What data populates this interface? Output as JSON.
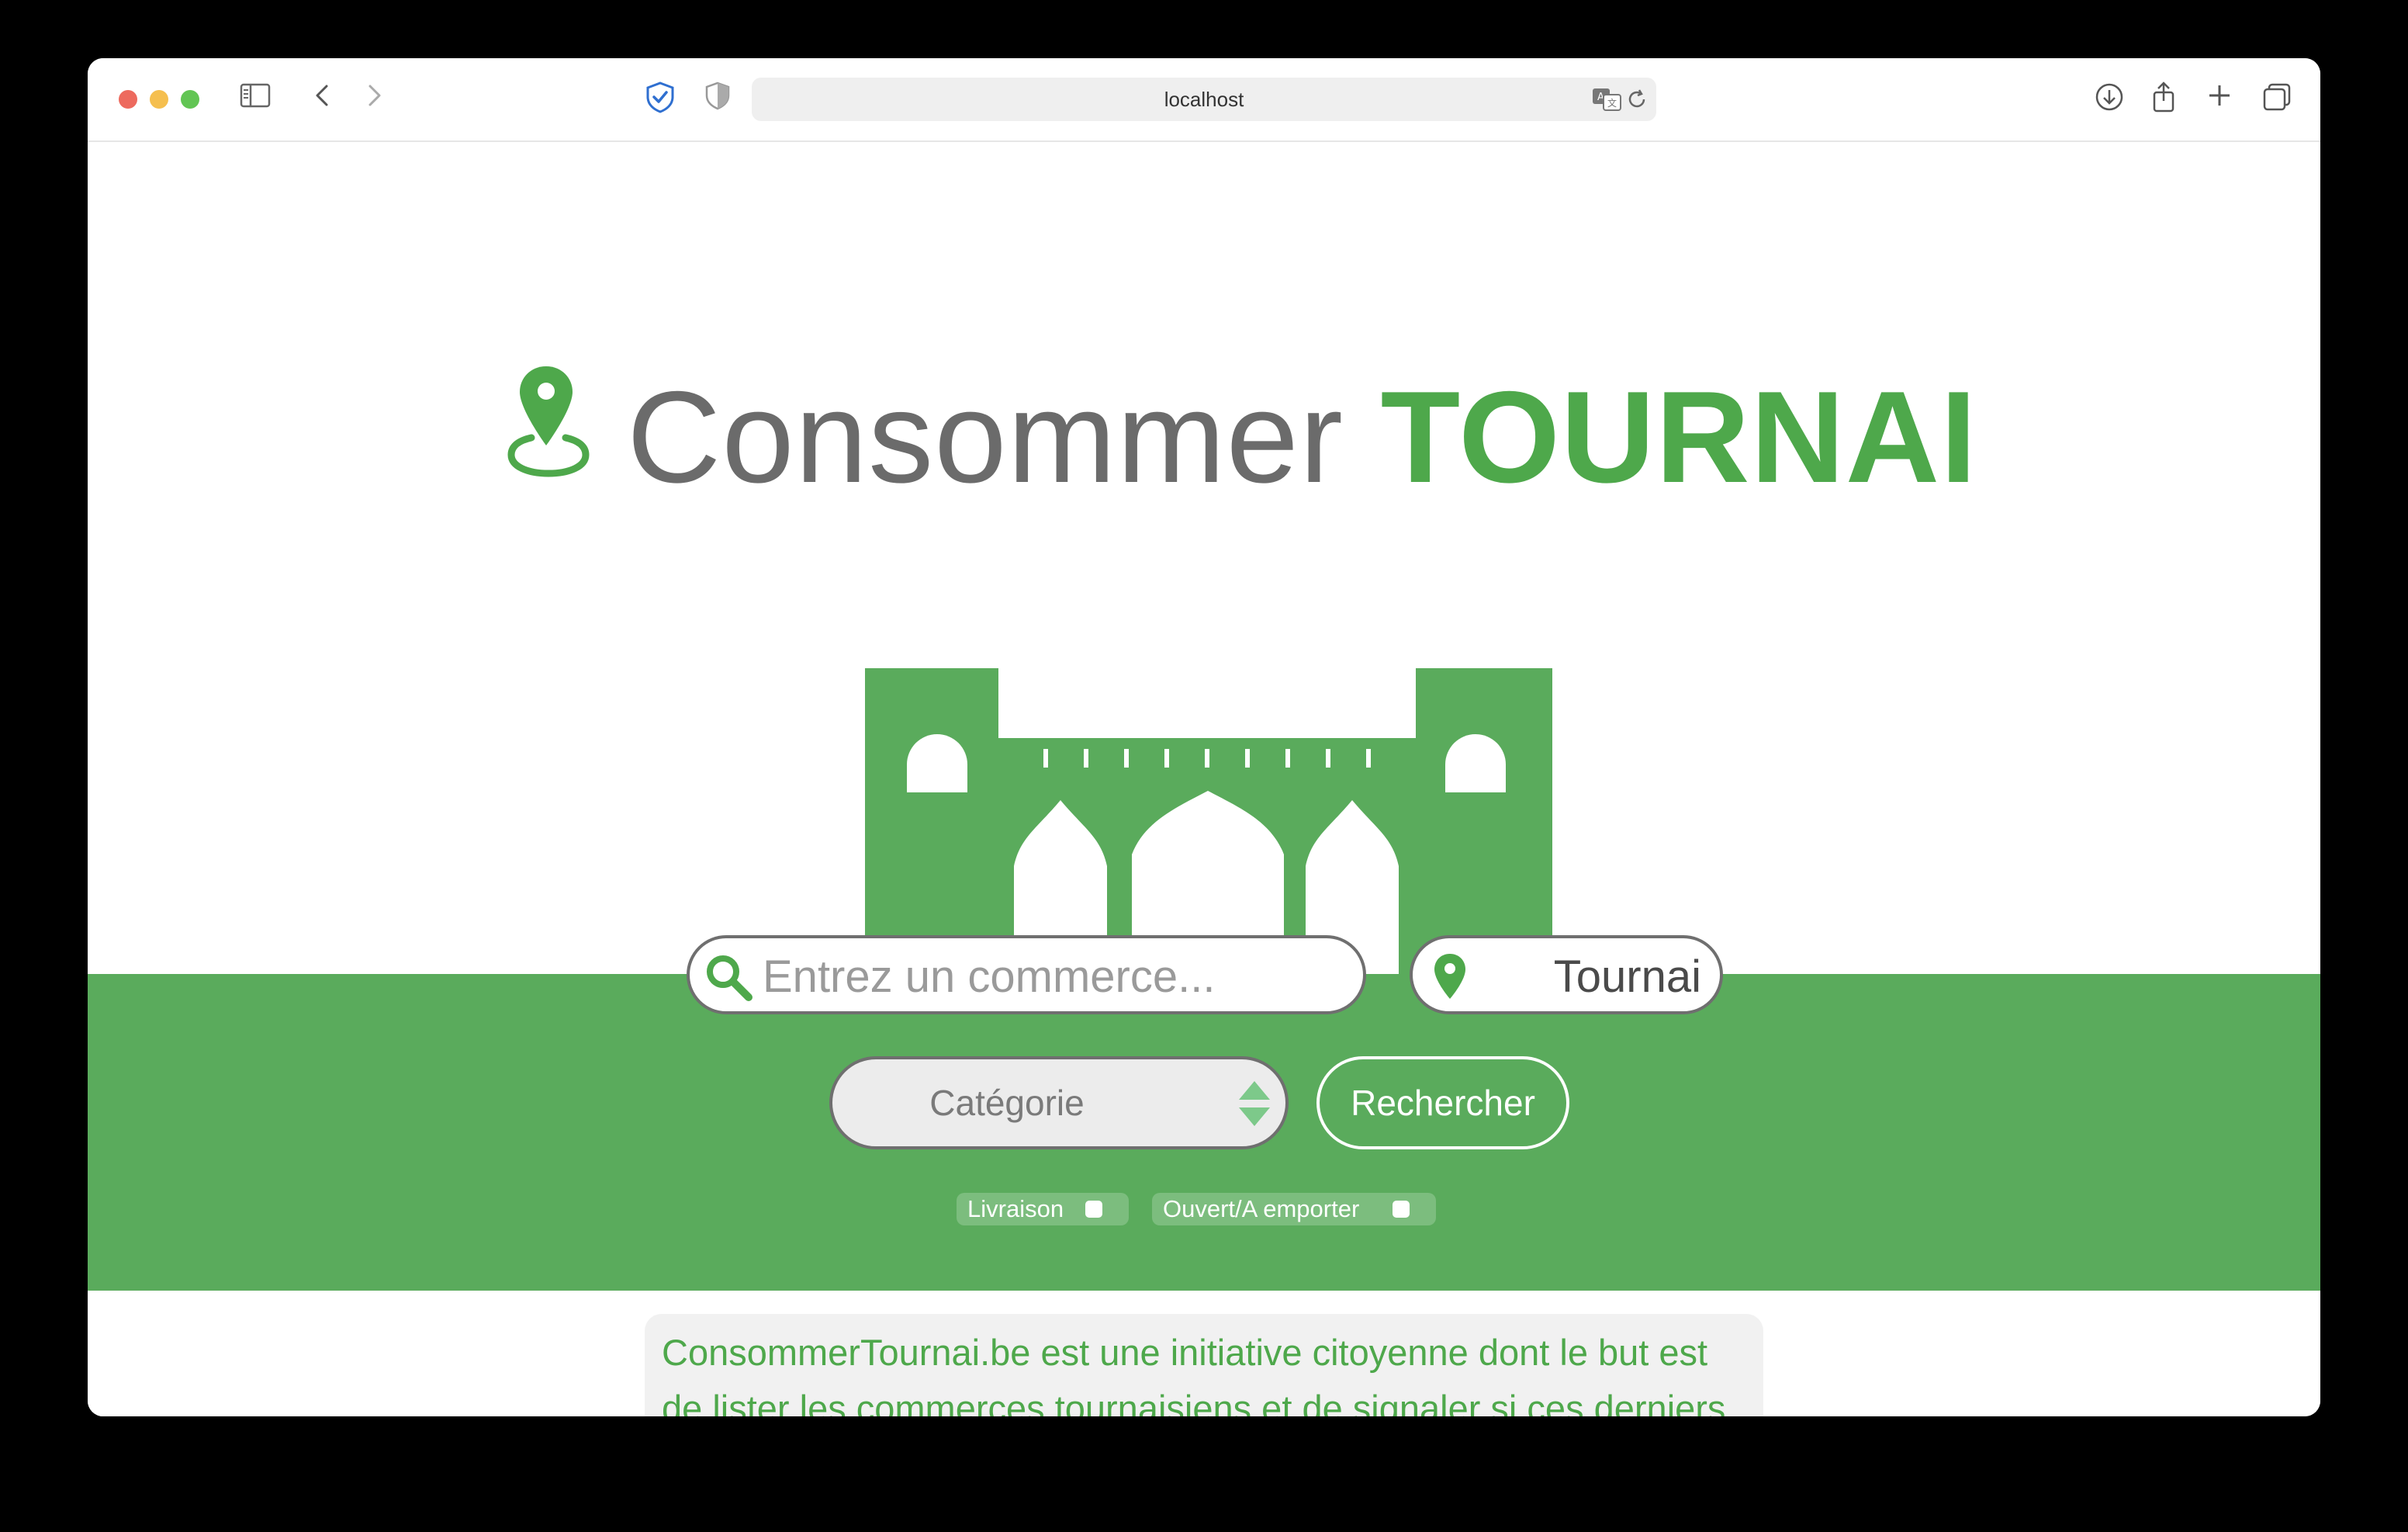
{
  "browser": {
    "url": "localhost",
    "icons": [
      "sidebar-icon",
      "back-icon",
      "forward-icon",
      "shield-check-icon",
      "privacy-icon",
      "translate-icon",
      "reload-icon",
      "download-icon",
      "share-icon",
      "new-tab-icon",
      "tabs-overview-icon"
    ]
  },
  "brand": {
    "light": "Consommer",
    "bold": "TOURNAI"
  },
  "search": {
    "placeholder": "Entrez un commerce...",
    "city": "Tournai",
    "category": "Catégorie",
    "button": "Rechercher"
  },
  "filters": {
    "delivery": "Livraison",
    "open": "Ouvert/A emporter"
  },
  "intro": {
    "text": "ConsommerTournai.be est une initiative citoyenne dont le but est de lister les commerces tournaisiens et de signaler si ces derniers sont ouverts ou livrent. Vous pouvez trier les commerces"
  },
  "colors": {
    "brand_green": "#4ea84b",
    "band_green": "#5aab5c",
    "text_grey": "#6b6b6b"
  }
}
